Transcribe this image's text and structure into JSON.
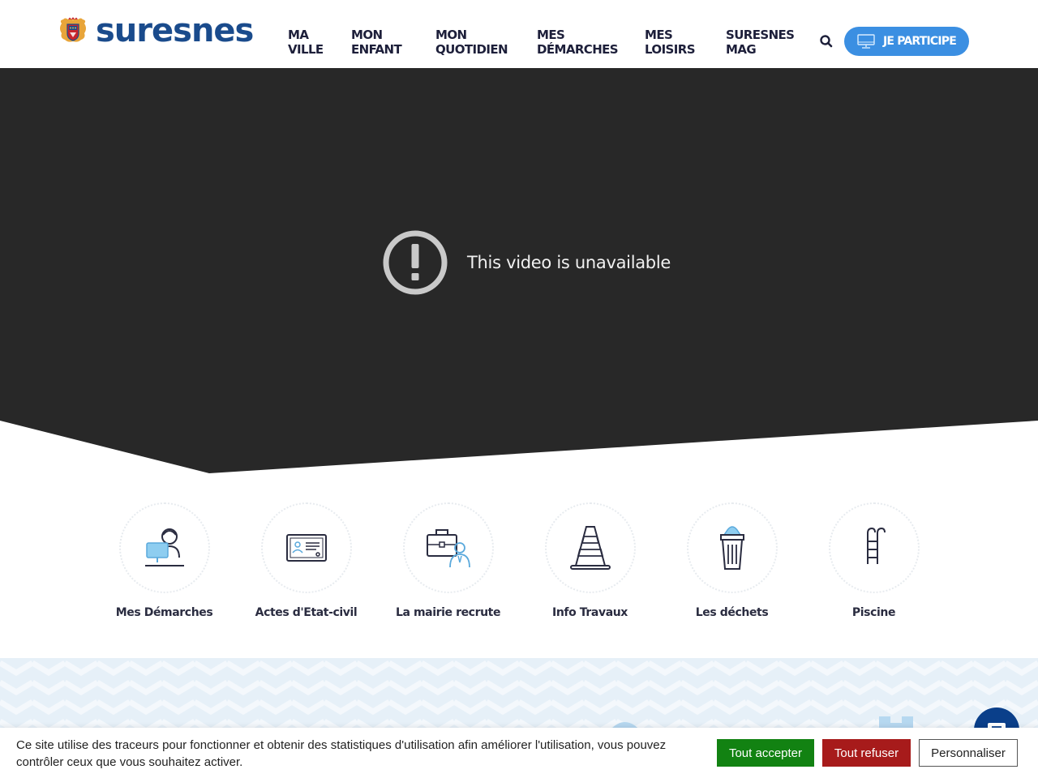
{
  "header": {
    "logo_text": "suresnes",
    "nav": [
      {
        "line1": "MA",
        "line2": "VILLE"
      },
      {
        "line1": "MON",
        "line2": "ENFANT"
      },
      {
        "line1": "MON",
        "line2": "QUOTIDIEN"
      },
      {
        "line1": "MES",
        "line2": "DÉMARCHES"
      },
      {
        "line1": "MES",
        "line2": "LOISIRS"
      },
      {
        "line1": "SURESNES",
        "line2": "MAG"
      }
    ],
    "search_icon": "search-icon",
    "participe_label": "JE PARTICIPE",
    "participe_icon": "monitor-icon",
    "accent_color": "#3b8fe2",
    "brand_color": "#1a4b8c"
  },
  "video": {
    "message": "This video is unavailable",
    "icon": "exclamation-circle-icon",
    "background": "#282828"
  },
  "quick_links": [
    {
      "label": "Mes Démarches",
      "icon": "person-computer-icon"
    },
    {
      "label": "Actes d'Etat-civil",
      "icon": "id-card-icon"
    },
    {
      "label": "La mairie recrute",
      "icon": "briefcase-person-icon"
    },
    {
      "label": "Info Travaux",
      "icon": "traffic-cone-icon"
    },
    {
      "label": "Les déchets",
      "icon": "trash-bin-icon"
    },
    {
      "label": "Piscine",
      "icon": "pool-ladder-icon"
    }
  ],
  "chat": {
    "icon": "chat-icon"
  },
  "cookie": {
    "text": "Ce site utilise des traceurs pour fonctionner et obtenir des statistiques d'utilisation afin améliorer l'utilisation, vous pouvez contrôler ceux que vous souhaitez activer.",
    "accept": "Tout accepter",
    "refuse": "Tout refuser",
    "customize": "Personnaliser"
  }
}
